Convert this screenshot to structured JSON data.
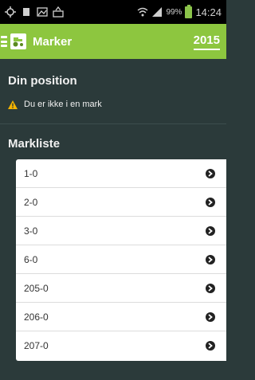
{
  "status_bar": {
    "battery_percent": "99%",
    "time": "14:24"
  },
  "app_bar": {
    "title": "Marker",
    "year": "2015"
  },
  "position": {
    "heading": "Din position",
    "status_text": "Du er ikke i en mark",
    "warning_color": "#f5b400"
  },
  "fields": {
    "heading": "Markliste",
    "items": [
      {
        "label": "1-0"
      },
      {
        "label": "2-0"
      },
      {
        "label": "3-0"
      },
      {
        "label": "6-0"
      },
      {
        "label": "205-0"
      },
      {
        "label": "206-0"
      },
      {
        "label": "207-0"
      }
    ]
  },
  "colors": {
    "accent": "#8dc63f",
    "background": "#2b3a3a"
  }
}
